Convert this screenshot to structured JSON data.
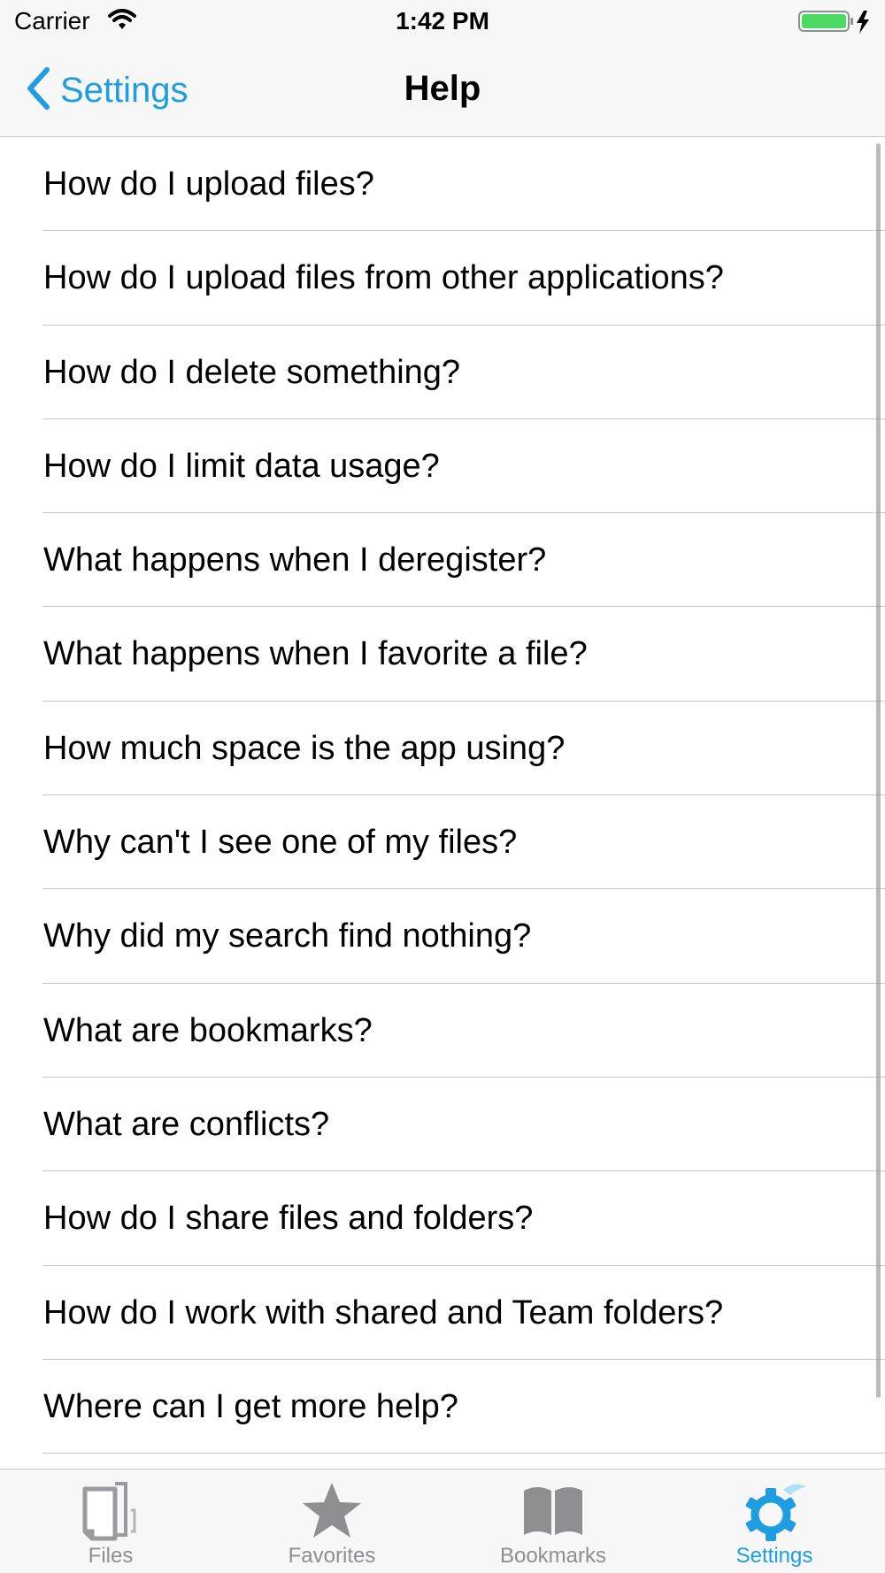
{
  "status_bar": {
    "carrier": "Carrier",
    "time": "1:42 PM",
    "wifi_icon": "wifi-icon",
    "battery_icon": "battery-charging-icon"
  },
  "nav": {
    "back_label": "Settings",
    "back_icon": "chevron-left-icon",
    "title": "Help"
  },
  "help_items": [
    {
      "label": "How do I upload files?"
    },
    {
      "label": "How do I upload files from other applications?"
    },
    {
      "label": "How do I delete something?"
    },
    {
      "label": "How do I limit data usage?"
    },
    {
      "label": "What happens when I deregister?"
    },
    {
      "label": "What happens when I favorite a file?"
    },
    {
      "label": "How much space is the app using?"
    },
    {
      "label": "Why can't I see one of my files?"
    },
    {
      "label": "Why did my search find nothing?"
    },
    {
      "label": "What are bookmarks?"
    },
    {
      "label": "What are conflicts?"
    },
    {
      "label": "How do I share files and folders?"
    },
    {
      "label": "How do I work with shared and Team folders?"
    },
    {
      "label": "Where can I get more help?"
    }
  ],
  "tabs": [
    {
      "label": "Files",
      "icon": "files-icon",
      "selected": false
    },
    {
      "label": "Favorites",
      "icon": "star-icon",
      "selected": false
    },
    {
      "label": "Bookmarks",
      "icon": "book-icon",
      "selected": false
    },
    {
      "label": "Settings",
      "icon": "gear-icon",
      "selected": true
    }
  ],
  "colors": {
    "accent": "#1e9ee0",
    "inactive": "#8e8e93",
    "bar_background": "#f7f7f7",
    "separator": "#c8c7cc",
    "battery": "#4cd964"
  }
}
